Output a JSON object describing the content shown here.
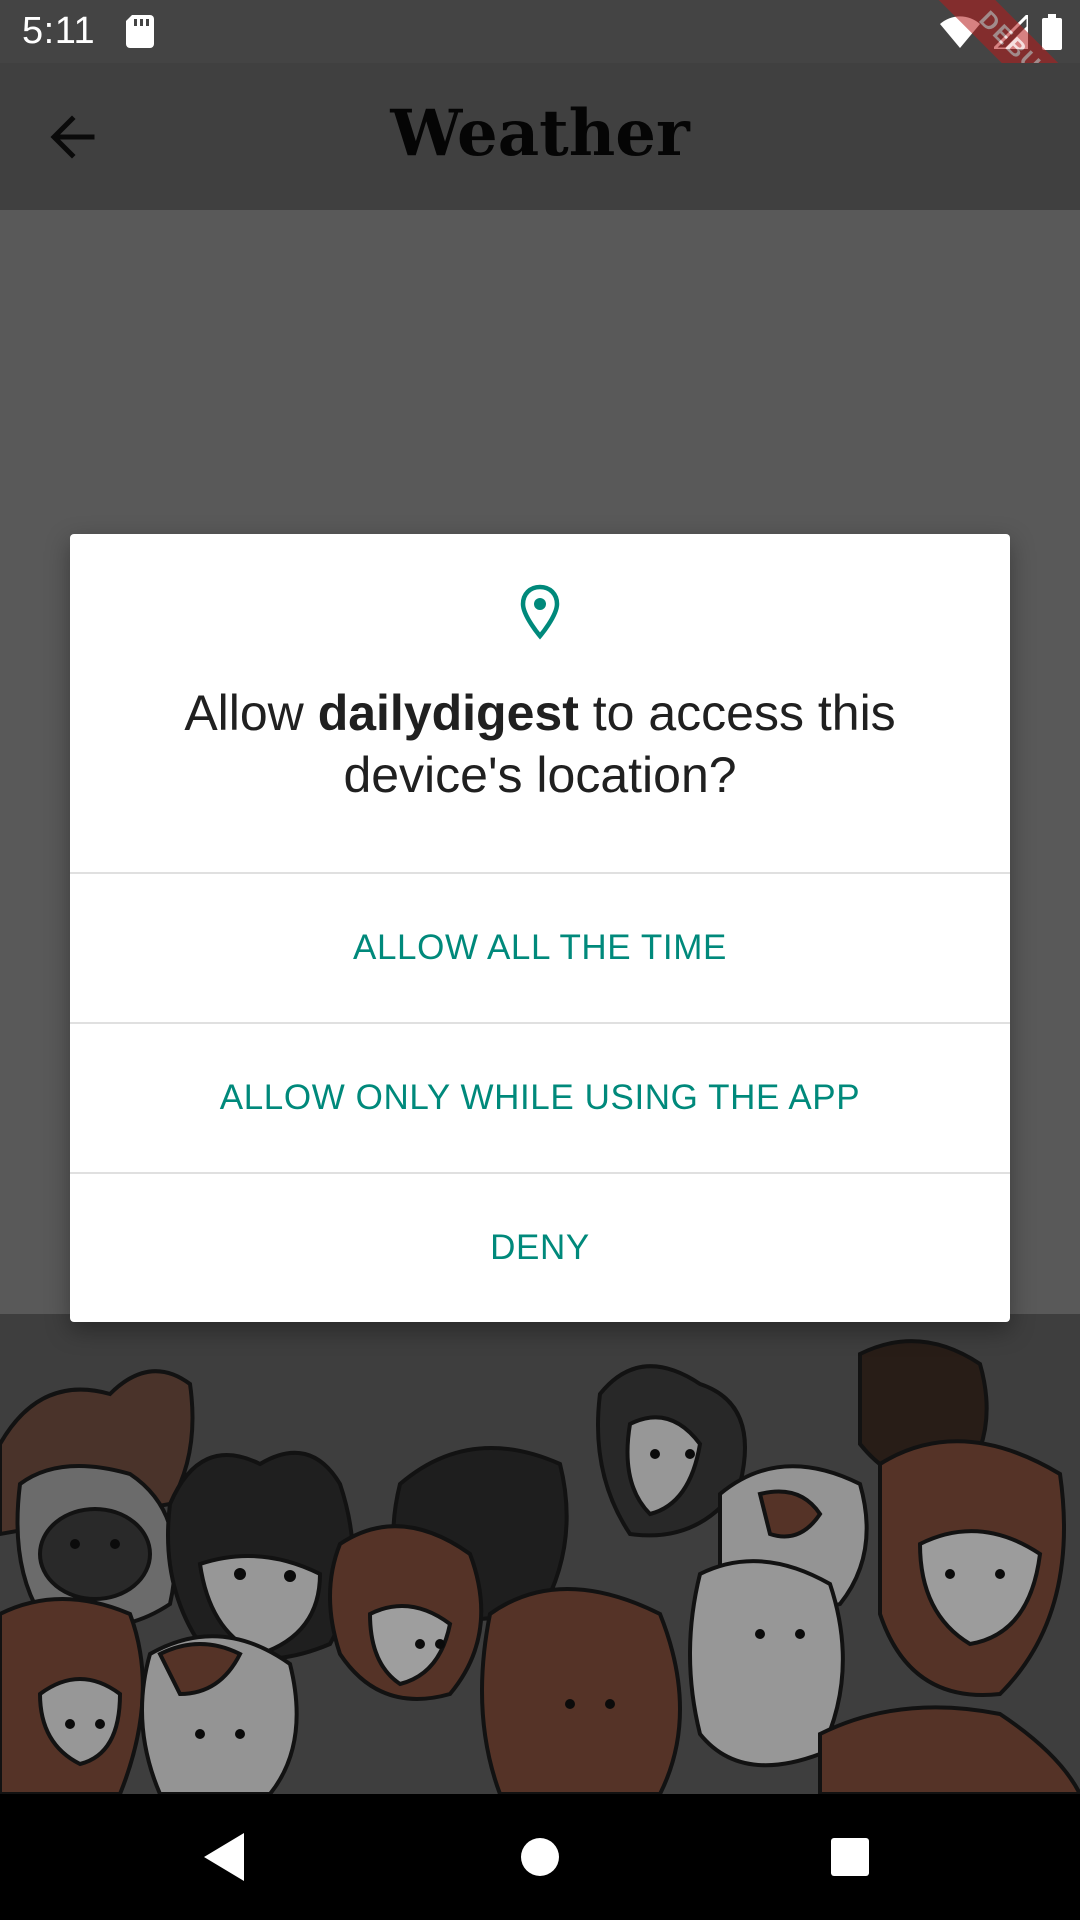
{
  "status_bar": {
    "time": "5:11",
    "debug_label": "DEBUG",
    "icons": [
      "sd-card-icon",
      "wifi-icon",
      "signal-icon",
      "battery-icon"
    ]
  },
  "app_bar": {
    "title": "Weather",
    "back_icon": "arrow-back-icon"
  },
  "dialog": {
    "icon": "location-pin-icon",
    "title_prefix": "Allow ",
    "app_name": "dailydigest",
    "title_suffix": " to access this device's location?",
    "buttons": {
      "allow_all": "ALLOW ALL THE TIME",
      "allow_while_using": "ALLOW ONLY WHILE USING THE APP",
      "deny": "DENY"
    }
  },
  "nav_bar": {
    "icons": [
      "back-triangle-icon",
      "home-circle-icon",
      "recents-square-icon"
    ]
  },
  "colors": {
    "accent": "#00897b",
    "dialog_bg": "#ffffff",
    "status_bar": "#444444",
    "app_bar": "#404040",
    "content_bg": "#595959"
  }
}
